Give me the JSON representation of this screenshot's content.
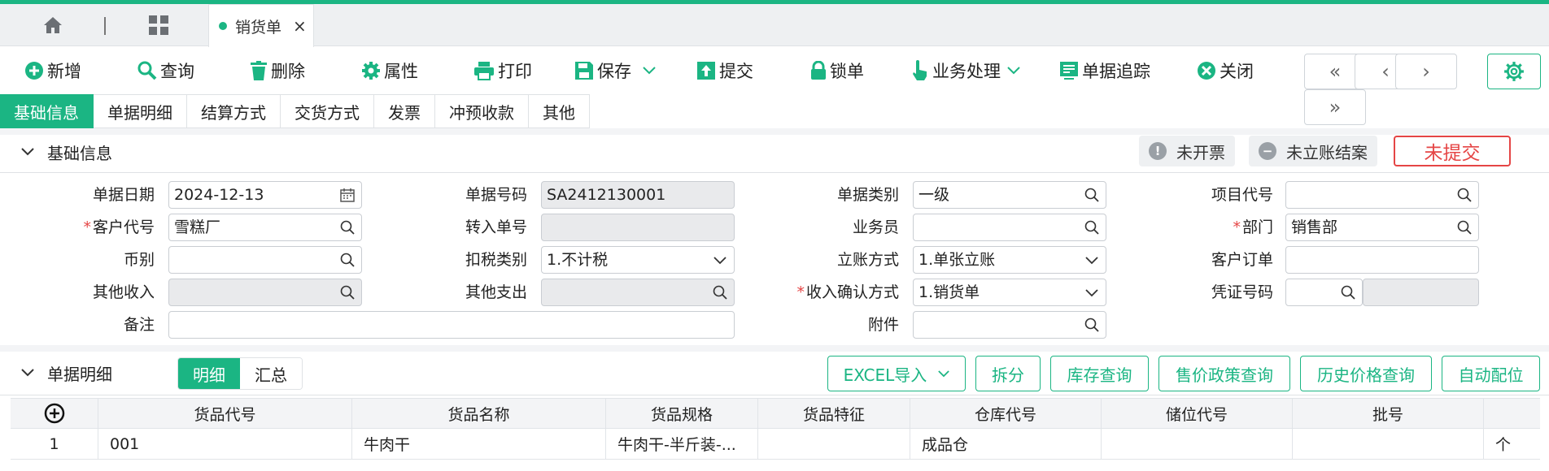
{
  "tabstrip": {
    "doc_tab": "销货单",
    "close": "×"
  },
  "toolbar": {
    "add": "新增",
    "query": "查询",
    "delete": "删除",
    "properties": "属性",
    "print": "打印",
    "save": "保存",
    "submit": "提交",
    "lock": "锁单",
    "business": "业务处理",
    "trace": "单据追踪",
    "close": "关闭",
    "nav": [
      "«",
      "‹",
      "›",
      "»"
    ]
  },
  "section_tabs": [
    "基础信息",
    "单据明细",
    "结算方式",
    "交货方式",
    "发票",
    "冲预收款",
    "其他"
  ],
  "basic": {
    "title": "基础信息",
    "badge_invoice": "未开票",
    "badge_account": "未立账结案",
    "status": "未提交",
    "labels": {
      "date": "单据日期",
      "doc_no": "单据号码",
      "doc_type": "单据类别",
      "project": "项目代号",
      "customer": "客户代号",
      "transfer": "转入单号",
      "salesman": "业务员",
      "dept": "部门",
      "currency": "币别",
      "tax": "扣税类别",
      "account_method": "立账方式",
      "cust_order": "客户订单",
      "other_income": "其他收入",
      "other_expense": "其他支出",
      "income_confirm": "收入确认方式",
      "voucher": "凭证号码",
      "remark": "备注",
      "attachment": "附件"
    },
    "values": {
      "date": "2024-12-13",
      "doc_no": "SA2412130001",
      "doc_type": "一级",
      "customer": "雪糕厂",
      "dept": "销售部",
      "tax": "1.不计税",
      "account_method": "1.单张立账",
      "income_confirm": "1.销货单"
    }
  },
  "detail": {
    "title": "单据明细",
    "seg": [
      "明细",
      "汇总"
    ],
    "buttons": [
      "EXCEL导入",
      "拆分",
      "库存查询",
      "售价政策查询",
      "历史价格查询",
      "自动配位"
    ],
    "columns": [
      "货品代号",
      "货品名称",
      "货品规格",
      "货品特征",
      "仓库代号",
      "储位代号",
      "批号"
    ],
    "rows": [
      {
        "no": "1",
        "code": "001",
        "name": "牛肉干",
        "spec": "牛肉干-半斤装-...",
        "feature": "",
        "warehouse": "成品仓",
        "location": "",
        "batch": "",
        "unit": "个"
      }
    ]
  },
  "colors": {
    "accent": "#1bb583",
    "danger": "#e54545"
  }
}
